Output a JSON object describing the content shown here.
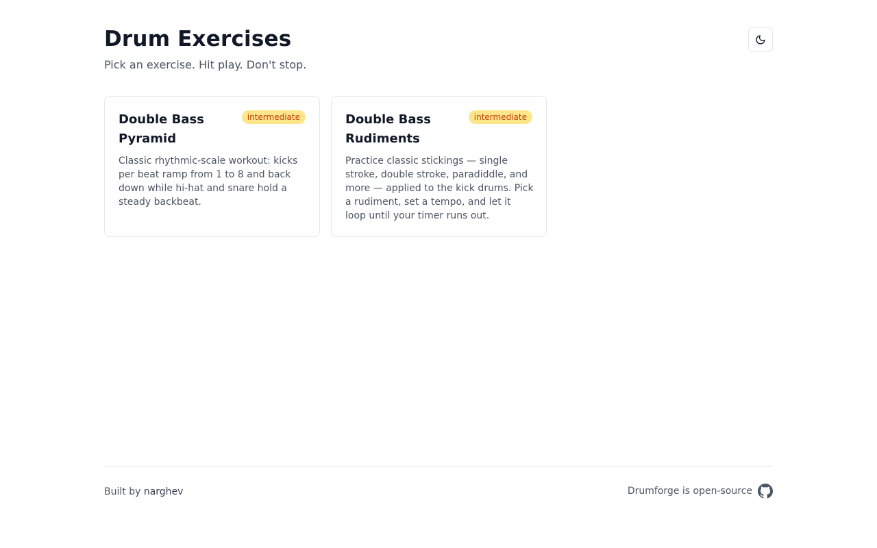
{
  "header": {
    "title": "Drum Exercises",
    "subtitle": "Pick an exercise. Hit play. Don't stop.",
    "theme_toggle_icon": "moon-icon"
  },
  "exercises": [
    {
      "title": "Double Bass Pyramid",
      "level": "intermediate",
      "description": "Classic rhythmic-scale workout: kicks per beat ramp from 1 to 8 and back down while hi-hat and snare hold a steady backbeat."
    },
    {
      "title": "Double Bass Rudiments",
      "level": "intermediate",
      "description": "Practice classic stickings — single stroke, double stroke, paradiddle, and more — applied to the kick drums. Pick a rudiment, set a tempo, and let it loop until your timer runs out."
    }
  ],
  "footer": {
    "built_by_prefix": "Built by",
    "author": "narghev",
    "open_source_text": "Drumforge is open-source",
    "repo_icon": "github-icon"
  },
  "colors": {
    "badge_bg": "#fde68a",
    "badge_text": "#c2410c",
    "text_primary": "#111827",
    "text_secondary": "#4b5563",
    "border": "#e5e7eb"
  }
}
